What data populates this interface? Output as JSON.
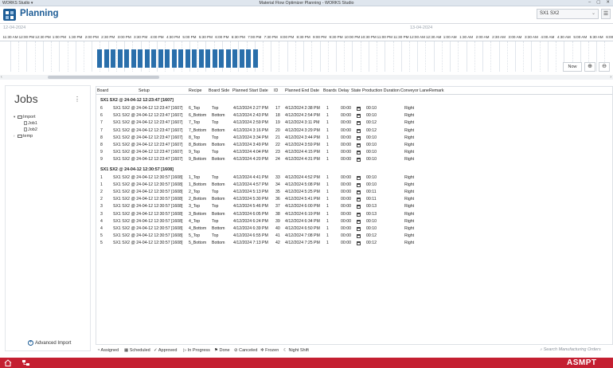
{
  "window": {
    "app_menu": "WORKS Studio ▾",
    "title": "Material Flow Optimizer Planning - WORKS Studio"
  },
  "header": {
    "title": "Planning",
    "line_select": "SX1 SX2"
  },
  "timeline": {
    "date_left": "12-04-2024",
    "date_right": "13-04-2024",
    "hours": [
      "11:30 AM",
      "12:00 PM",
      "12:30 PM",
      "1:00 PM",
      "1:30 PM",
      "2:00 PM",
      "2:30 PM",
      "3:00 PM",
      "3:30 PM",
      "4:00 PM",
      "4:30 PM",
      "5:00 PM",
      "5:30 PM",
      "6:00 PM",
      "6:30 PM",
      "7:00 PM",
      "7:30 PM",
      "8:00 PM",
      "8:30 PM",
      "9:00 PM",
      "9:30 PM",
      "10:00 PM",
      "10:30 PM",
      "11:00 PM",
      "11:30 PM",
      "12:00 AM",
      "12:30 AM",
      "1:00 AM",
      "1:30 AM",
      "2:00 AM",
      "2:30 AM",
      "3:00 AM",
      "3:30 AM",
      "4:00 AM",
      "4:30 AM",
      "5:00 AM",
      "5:30 AM",
      "6:00 AM"
    ],
    "bar_count": 24,
    "now_label": "Now",
    "bar_color": "#2a6fab"
  },
  "jobs": {
    "title": "Jobs",
    "tree": [
      {
        "label": "Import",
        "level": 0,
        "kind": "folder",
        "caret": "▾"
      },
      {
        "label": "Job1",
        "level": 1,
        "kind": "file",
        "caret": ""
      },
      {
        "label": "Job2",
        "level": 1,
        "kind": "file",
        "caret": ""
      },
      {
        "label": "temp",
        "level": 0,
        "kind": "folder",
        "caret": "›"
      }
    ],
    "advanced_import": "Advanced Import"
  },
  "table": {
    "columns": [
      "Board",
      "Setup",
      "Recipe",
      "Board Side",
      "Planned Start Date",
      "ID",
      "Planned End Date",
      "Boards",
      "Delay",
      "State",
      "Production Duration",
      "Conveyor Lane",
      "Remark"
    ],
    "groups": [
      {
        "title": "SX1 SX2 @ 24-04-12 12:23:47 [1607]",
        "rows": [
          [
            "6",
            "SX1 SX2 @ 24-04-12 12:23:47 [1607]",
            "6_Top",
            "Top",
            "4/12/2024 2:27 PM",
            "17",
            "4/12/2024 2:38 PM",
            "1",
            "00:00",
            "00:10",
            "Right"
          ],
          [
            "6",
            "SX1 SX2 @ 24-04-12 12:23:47 [1607]",
            "6_Bottom",
            "Bottom",
            "4/12/2024 2:43 PM",
            "18",
            "4/12/2024 2:54 PM",
            "1",
            "00:00",
            "00:10",
            "Right"
          ],
          [
            "7",
            "SX1 SX2 @ 24-04-12 12:23:47 [1607]",
            "7_Top",
            "Top",
            "4/12/2024 2:59 PM",
            "19",
            "4/12/2024 3:11 PM",
            "1",
            "00:00",
            "00:12",
            "Right"
          ],
          [
            "7",
            "SX1 SX2 @ 24-04-12 12:23:47 [1607]",
            "7_Bottom",
            "Bottom",
            "4/12/2024 3:16 PM",
            "20",
            "4/12/2024 3:29 PM",
            "1",
            "00:00",
            "00:12",
            "Right"
          ],
          [
            "8",
            "SX1 SX2 @ 24-04-12 12:23:47 [1607]",
            "8_Top",
            "Top",
            "4/12/2024 3:34 PM",
            "21",
            "4/12/2024 3:44 PM",
            "1",
            "00:00",
            "00:10",
            "Right"
          ],
          [
            "8",
            "SX1 SX2 @ 24-04-12 12:23:47 [1607]",
            "8_Bottom",
            "Bottom",
            "4/12/2024 3:49 PM",
            "22",
            "4/12/2024 3:59 PM",
            "1",
            "00:00",
            "00:10",
            "Right"
          ],
          [
            "9",
            "SX1 SX2 @ 24-04-12 12:23:47 [1607]",
            "9_Top",
            "Top",
            "4/12/2024 4:04 PM",
            "23",
            "4/12/2024 4:15 PM",
            "1",
            "00:00",
            "00:10",
            "Right"
          ],
          [
            "9",
            "SX1 SX2 @ 24-04-12 12:23:47 [1607]",
            "9_Bottom",
            "Bottom",
            "4/12/2024 4:20 PM",
            "24",
            "4/12/2024 4:31 PM",
            "1",
            "00:00",
            "00:10",
            "Right"
          ]
        ]
      },
      {
        "title": "SX1 SX2 @ 24-04-12 12:30:57 [1608]",
        "rows": [
          [
            "1",
            "SX1 SX2 @ 24-04-12 12:30:57 [1608]",
            "1_Top",
            "Top",
            "4/12/2024 4:41 PM",
            "33",
            "4/12/2024 4:52 PM",
            "1",
            "00:00",
            "00:10",
            "Right"
          ],
          [
            "1",
            "SX1 SX2 @ 24-04-12 12:30:57 [1608]",
            "1_Bottom",
            "Bottom",
            "4/12/2024 4:57 PM",
            "34",
            "4/12/2024 5:08 PM",
            "1",
            "00:00",
            "00:10",
            "Right"
          ],
          [
            "2",
            "SX1 SX2 @ 24-04-12 12:30:57 [1608]",
            "2_Top",
            "Top",
            "4/12/2024 5:13 PM",
            "35",
            "4/12/2024 5:25 PM",
            "1",
            "00:00",
            "00:11",
            "Right"
          ],
          [
            "2",
            "SX1 SX2 @ 24-04-12 12:30:57 [1608]",
            "2_Bottom",
            "Bottom",
            "4/12/2024 5:30 PM",
            "36",
            "4/12/2024 5:41 PM",
            "1",
            "00:00",
            "00:11",
            "Right"
          ],
          [
            "3",
            "SX1 SX2 @ 24-04-12 12:30:57 [1608]",
            "3_Top",
            "Top",
            "4/12/2024 5:46 PM",
            "37",
            "4/12/2024 6:00 PM",
            "1",
            "00:00",
            "00:13",
            "Right"
          ],
          [
            "3",
            "SX1 SX2 @ 24-04-12 12:30:57 [1608]",
            "3_Bottom",
            "Bottom",
            "4/12/2024 6:05 PM",
            "38",
            "4/12/2024 6:19 PM",
            "1",
            "00:00",
            "00:13",
            "Right"
          ],
          [
            "4",
            "SX1 SX2 @ 24-04-12 12:30:57 [1608]",
            "4_Top",
            "Top",
            "4/12/2024 6:24 PM",
            "39",
            "4/12/2024 6:34 PM",
            "1",
            "00:00",
            "00:10",
            "Right"
          ],
          [
            "4",
            "SX1 SX2 @ 24-04-12 12:30:57 [1608]",
            "4_Bottom",
            "Bottom",
            "4/12/2024 6:39 PM",
            "40",
            "4/12/2024 6:50 PM",
            "1",
            "00:00",
            "00:10",
            "Right"
          ],
          [
            "5",
            "SX1 SX2 @ 24-04-12 12:30:57 [1608]",
            "5_Top",
            "Top",
            "4/12/2024 6:55 PM",
            "41",
            "4/12/2024 7:08 PM",
            "1",
            "00:00",
            "00:12",
            "Right"
          ],
          [
            "5",
            "SX1 SX2 @ 24-04-12 12:30:57 [1608]",
            "5_Bottom",
            "Bottom",
            "4/12/2024 7:13 PM",
            "42",
            "4/12/2024 7:25 PM",
            "1",
            "00:00",
            "00:12",
            "Right"
          ]
        ]
      }
    ]
  },
  "legend": [
    {
      "label": "Assigned",
      "icon": "assigned-icon"
    },
    {
      "label": "Scheduled",
      "icon": "calendar-icon"
    },
    {
      "label": "Approved",
      "icon": "check-circle-icon"
    },
    {
      "label": "In Progress",
      "icon": "play-icon"
    },
    {
      "label": "Done",
      "icon": "flag-icon"
    },
    {
      "label": "Canceled",
      "icon": "cancel-icon"
    },
    {
      "label": "Frozen",
      "icon": "frozen-icon"
    },
    {
      "label": "Night Shift",
      "icon": "moon-icon"
    }
  ],
  "search_orders_placeholder": "Search Manufacturing Orders",
  "brand": "ASMPT",
  "colors": {
    "accent": "#1e5d96",
    "brand_bar": "#c41f31"
  }
}
